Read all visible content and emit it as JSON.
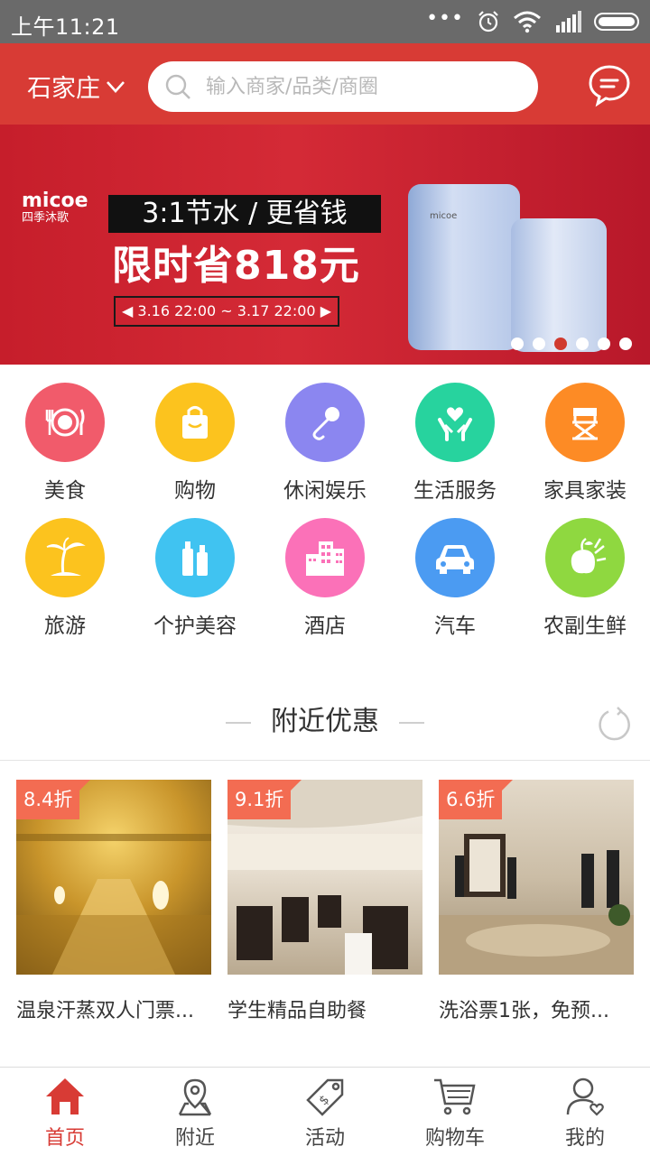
{
  "status_bar": {
    "time": "上午11:21",
    "overflow": "•••"
  },
  "header": {
    "city": "石家庄",
    "search_placeholder": "输入商家/品类/商圈"
  },
  "banner": {
    "brand_en": "micoe",
    "brand_cn": "四季沐歌",
    "headline": "3:1节水 / 更省钱",
    "promo": "限时省818元",
    "date_range": "◀ 3.16 22:00 ~ 3.17 22:00 ▶",
    "product_label": "micoe",
    "slides": 6,
    "active_slide": 3
  },
  "categories": [
    {
      "label": "美食",
      "icon": "food-icon",
      "color": "#f15b6b"
    },
    {
      "label": "购物",
      "icon": "shopping-bag-icon",
      "color": "#fcc31e"
    },
    {
      "label": "休闲娱乐",
      "icon": "microphone-icon",
      "color": "#8b86f0"
    },
    {
      "label": "生活服务",
      "icon": "heart-hands-icon",
      "color": "#27d39e"
    },
    {
      "label": "家具家装",
      "icon": "directors-chair-icon",
      "color": "#fd8b25"
    },
    {
      "label": "旅游",
      "icon": "palm-tree-icon",
      "color": "#fcc31e"
    },
    {
      "label": "个护美容",
      "icon": "cosmetics-icon",
      "color": "#40c3f1"
    },
    {
      "label": "酒店",
      "icon": "hotel-building-icon",
      "color": "#fb71b8"
    },
    {
      "label": "汽车",
      "icon": "car-icon",
      "color": "#4b9bf2"
    },
    {
      "label": "农副生鲜",
      "icon": "fruit-icon",
      "color": "#8fd840"
    }
  ],
  "nearby": {
    "title": "附近优惠",
    "deals": [
      {
        "discount": "8.4折",
        "title": "温泉汗蒸双人门票..."
      },
      {
        "discount": "9.1折",
        "title": "学生精品自助餐"
      },
      {
        "discount": "6.6折",
        "title": "洗浴票1张，免预..."
      }
    ]
  },
  "bottom_nav": [
    {
      "label": "首页",
      "icon": "home-icon",
      "active": true
    },
    {
      "label": "附近",
      "icon": "location-pin-icon",
      "active": false
    },
    {
      "label": "活动",
      "icon": "tag-icon",
      "active": false
    },
    {
      "label": "购物车",
      "icon": "cart-icon",
      "active": false
    },
    {
      "label": "我的",
      "icon": "user-icon",
      "active": false
    }
  ],
  "colors": {
    "brand_red": "#d83b35",
    "discount_tag": "#f36c52"
  }
}
